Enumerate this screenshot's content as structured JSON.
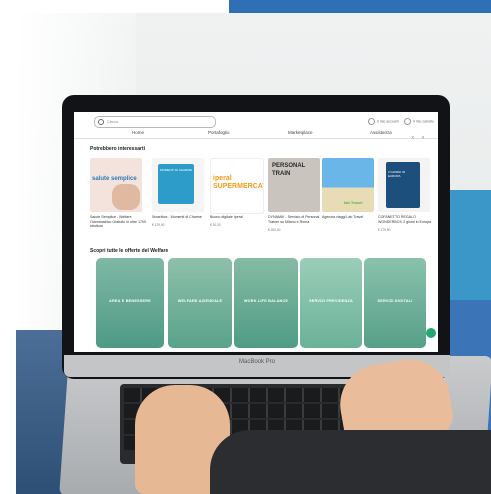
{
  "device": {
    "model_label": "MacBook Pro"
  },
  "screen": {
    "search": {
      "placeholder": "Cerca"
    },
    "account": {
      "left": "Il mio account",
      "right": "Il mio carrello"
    },
    "nav": [
      "Home",
      "Portafoglio",
      "Marketplace",
      "Assistenza"
    ],
    "section_suggestions": {
      "title": "Potrebbero interessarti",
      "cards": [
        {
          "title": "Salute Semplice - Welfare Odontoiatrico Gratuito in oltre 1700 strutture",
          "brand": "salute semplice",
          "price": ""
        },
        {
          "title": "Smartbox - Momenti di Charme",
          "brand": "MOMENTI DI CHARME",
          "price": "€ 129,90"
        },
        {
          "title": "Buono digitale Iperal",
          "brand": "iperal SUPERMERCATI",
          "price": "€ 20,00"
        },
        {
          "title": "DYNAMIK - Servizio di Personal Trainer su Milano e Roma",
          "brand": "PERSONAL TRAIN",
          "price": "€ 200,00"
        },
        {
          "title": "Agenzia viaggi Lab Travel",
          "brand": "lab Travel",
          "price": ""
        },
        {
          "title": "COFANETTO REGALO WONDERBOX 3 giorni in Europa",
          "brand": "3 GIORNI IN EUROPA",
          "price": "€ 179,90"
        }
      ]
    },
    "section_welfare": {
      "title": "Scopri tutte le offerte del Welfare",
      "tiles": [
        "AREA E BENESSERE",
        "WELFARE AZIENDALE",
        "WORK LIFE BALANCE",
        "SERVIZI PREVIDENZA",
        "SERVIZI DIGITALI"
      ]
    }
  },
  "colors": {
    "top_bar": "#2f6fb3",
    "tile_overlay": "#4ea88f",
    "fab": "#23a872"
  }
}
